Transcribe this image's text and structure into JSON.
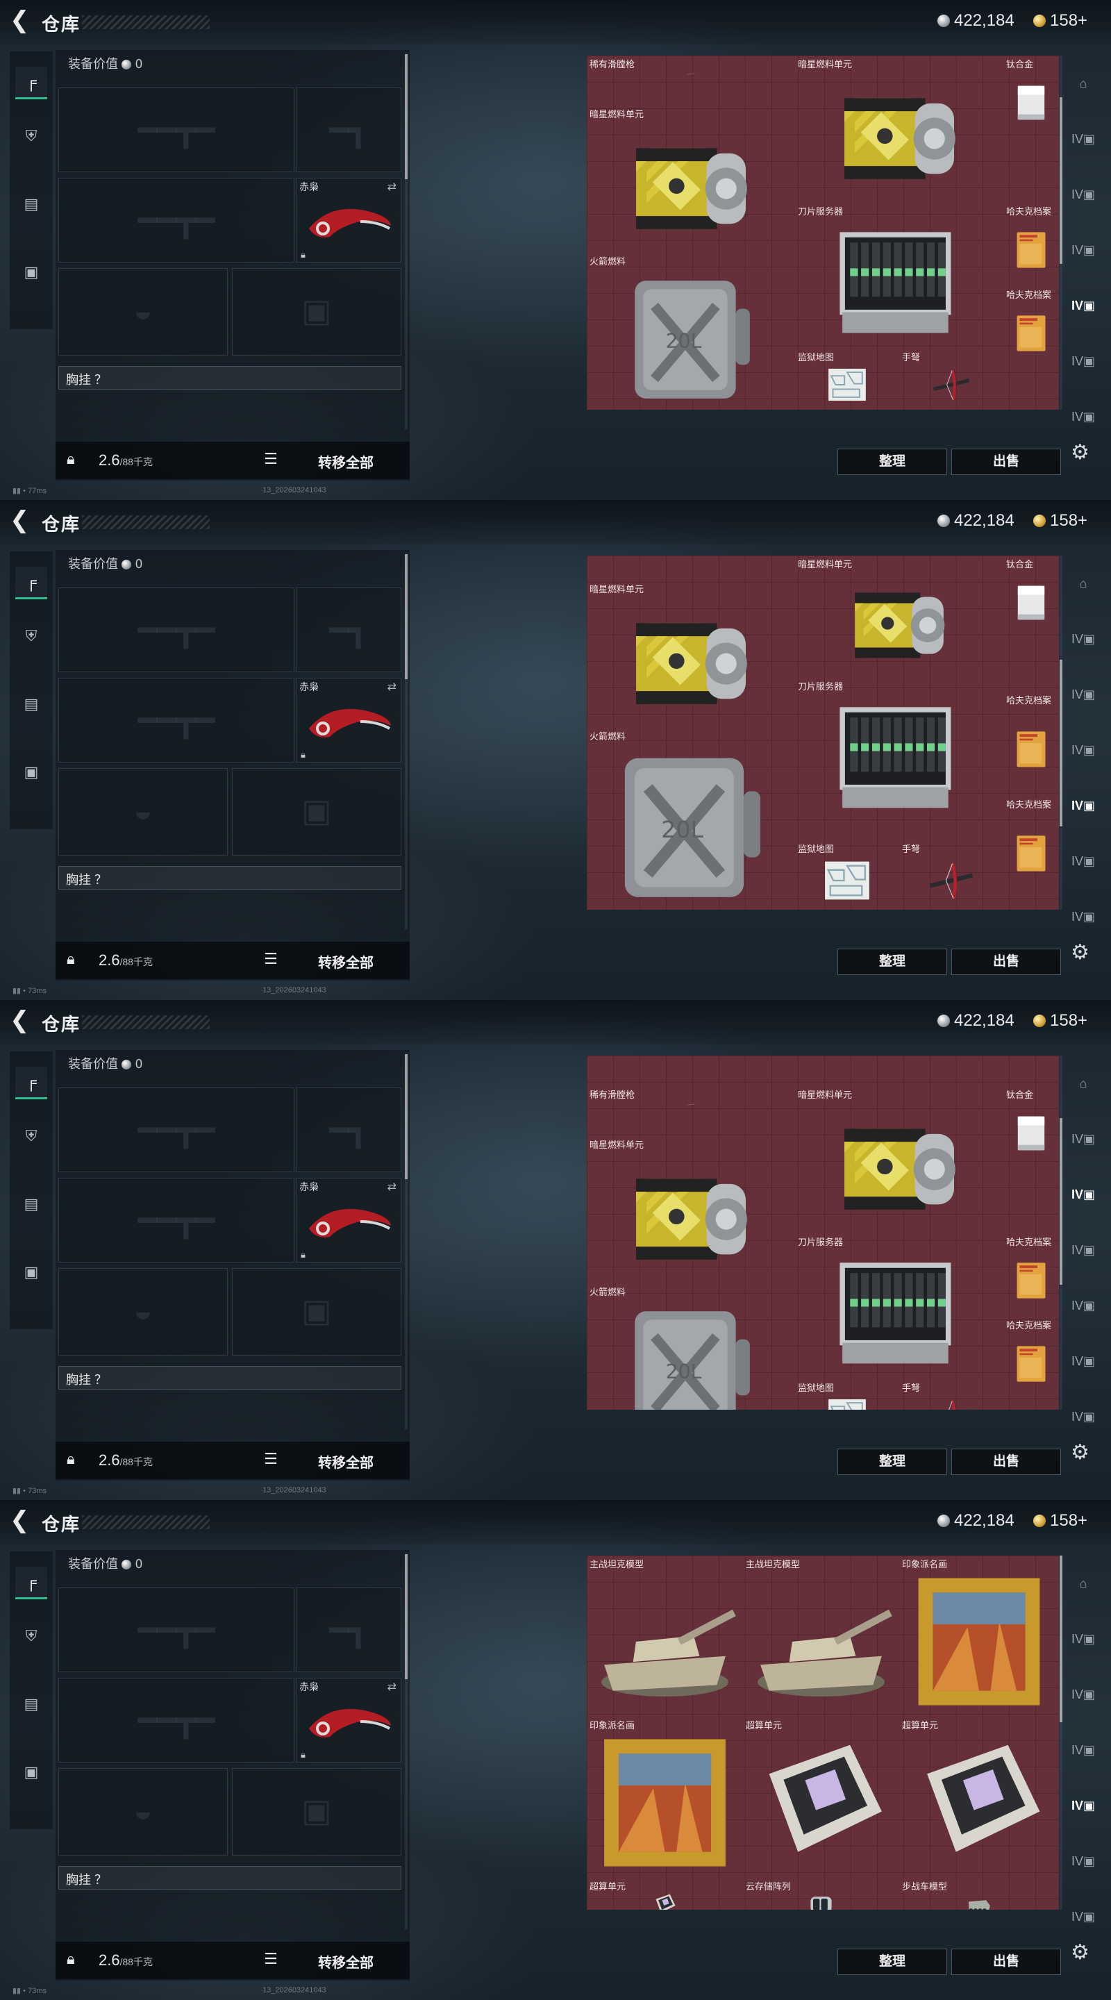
{
  "header": {
    "title": "仓库",
    "silver_amount": "422,184",
    "gold_amount": "158+"
  },
  "left_nav": {
    "tabs": [
      "weapon-tab-icon",
      "armor-tab-icon",
      "clipboard-tab-icon",
      "briefcase-tab-icon"
    ]
  },
  "equipment": {
    "value_label": "装备价值",
    "value": "0",
    "knife_name": "赤枭",
    "chest_label": "胸挂 ？",
    "weight": "2.6",
    "weight_cap": "/88千克",
    "move_all": "转移全部"
  },
  "actions": {
    "sort": "整理",
    "sell": "出售"
  },
  "screens": [
    {
      "ping": "77ms",
      "build": "13_202603241043",
      "items": [
        {
          "name": "稀有滑膛枪",
          "kind": "musket"
        },
        {
          "name": "暗星燃料单元",
          "kind": "fuel-cell"
        },
        {
          "name": "暗星燃料单元",
          "kind": "fuel-cell"
        },
        {
          "name": "钛合金",
          "kind": "metal"
        },
        {
          "name": "刀片服务器",
          "kind": "server"
        },
        {
          "name": "哈夫克档案",
          "kind": "file"
        },
        {
          "name": "哈夫克档案",
          "kind": "file"
        },
        {
          "name": "火箭燃料",
          "kind": "jerrycan"
        },
        {
          "name": "监狱地图",
          "kind": "map"
        },
        {
          "name": "手弩",
          "kind": "crossbow"
        }
      ]
    },
    {
      "ping": "73ms",
      "build": "13_202603241043",
      "items": [
        {
          "name": "暗星燃料单元",
          "kind": "fuel-cell"
        },
        {
          "name": "暗星燃料单元",
          "kind": "fuel-cell"
        },
        {
          "name": "钛合金",
          "kind": "metal"
        },
        {
          "name": "刀片服务器",
          "kind": "server"
        },
        {
          "name": "哈夫克档案",
          "kind": "file"
        },
        {
          "name": "哈夫克档案",
          "kind": "file"
        },
        {
          "name": "火箭燃料",
          "kind": "jerrycan"
        },
        {
          "name": "监狱地图",
          "kind": "map"
        },
        {
          "name": "手弩",
          "kind": "crossbow"
        }
      ]
    },
    {
      "ping": "73ms",
      "build": "13_202603241043",
      "items": [
        {
          "name": "稀有滑膛枪",
          "kind": "musket"
        },
        {
          "name": "暗星燃料单元",
          "kind": "fuel-cell"
        },
        {
          "name": "暗星燃料单元",
          "kind": "fuel-cell"
        },
        {
          "name": "钛合金",
          "kind": "metal"
        },
        {
          "name": "刀片服务器",
          "kind": "server"
        },
        {
          "name": "哈夫克档案",
          "kind": "file"
        },
        {
          "name": "哈夫克档案",
          "kind": "file"
        },
        {
          "name": "火箭燃料",
          "kind": "jerrycan"
        },
        {
          "name": "监狱地图",
          "kind": "map"
        },
        {
          "name": "手弩",
          "kind": "crossbow"
        }
      ]
    },
    {
      "ping": "73ms",
      "build": "13_202603241043",
      "items": [
        {
          "name": "主战坦克模型",
          "kind": "tank"
        },
        {
          "name": "主战坦克模型",
          "kind": "tank"
        },
        {
          "name": "印象派名画",
          "kind": "painting"
        },
        {
          "name": "印象派名画",
          "kind": "painting"
        },
        {
          "name": "超算单元",
          "kind": "gpu"
        },
        {
          "name": "超算单元",
          "kind": "gpu"
        },
        {
          "name": "超算单元",
          "kind": "gpu"
        },
        {
          "name": "云存储阵列",
          "kind": "storage"
        },
        {
          "name": "步战车模型",
          "kind": "ifv"
        }
      ]
    }
  ]
}
